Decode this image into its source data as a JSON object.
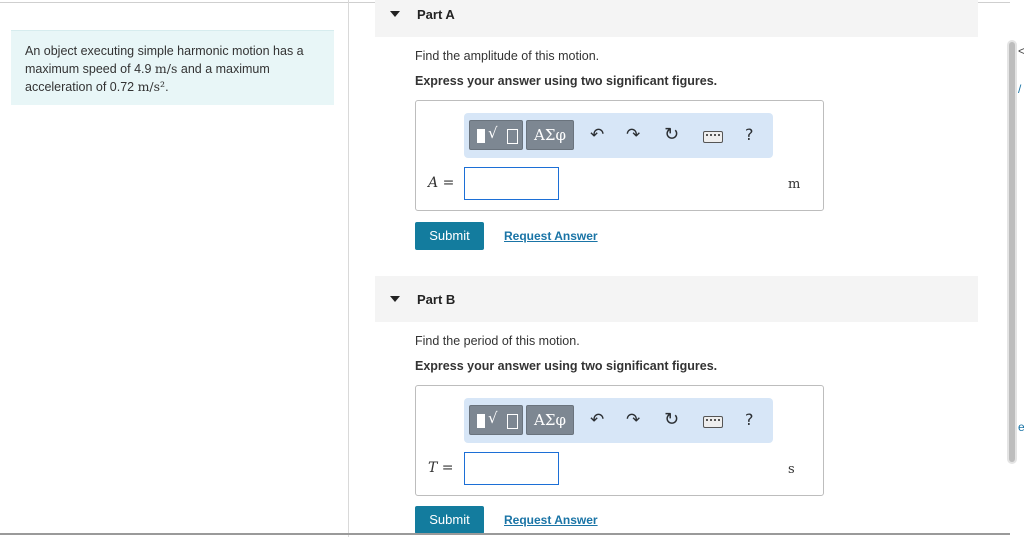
{
  "problem": {
    "line1": "An object executing simple harmonic motion has a",
    "line2_pre": "maximum speed of 4.9 ",
    "speed_unit": "m/s",
    "line2_post": " and a maximum",
    "line3_pre": "acceleration of 0.72 ",
    "accel_unit": "m/s²",
    "line3_post": "."
  },
  "parts": [
    {
      "title": "Part A",
      "prompt": "Find the amplitude of this motion.",
      "instruction": "Express your answer using two significant figures.",
      "variable": "A",
      "equals": "=",
      "input_value": "",
      "unit": "m",
      "submit_label": "Submit",
      "request_label": "Request Answer"
    },
    {
      "title": "Part B",
      "prompt": "Find the period of this motion.",
      "instruction": "Express your answer using two significant figures.",
      "variable": "T",
      "equals": "=",
      "input_value": "",
      "unit": "s",
      "submit_label": "Submit",
      "request_label": "Request Answer"
    }
  ],
  "toolbar": {
    "templates_icon": "templates-icon",
    "greek_label": "ΑΣφ",
    "undo_icon": "↶",
    "redo_icon": "↷",
    "reset_icon": "↻",
    "keyboard_icon": "keyboard-icon",
    "help_label": "?"
  },
  "edge": {
    "glyph1": "<",
    "glyph2": "/",
    "glyph3": "e"
  },
  "colors": {
    "problem_bg": "#e8f6f7",
    "toolbar_bg": "#d7e6f7",
    "submit_bg": "#137c9e",
    "link": "#1a74a6",
    "input_border": "#1c6fd6"
  }
}
